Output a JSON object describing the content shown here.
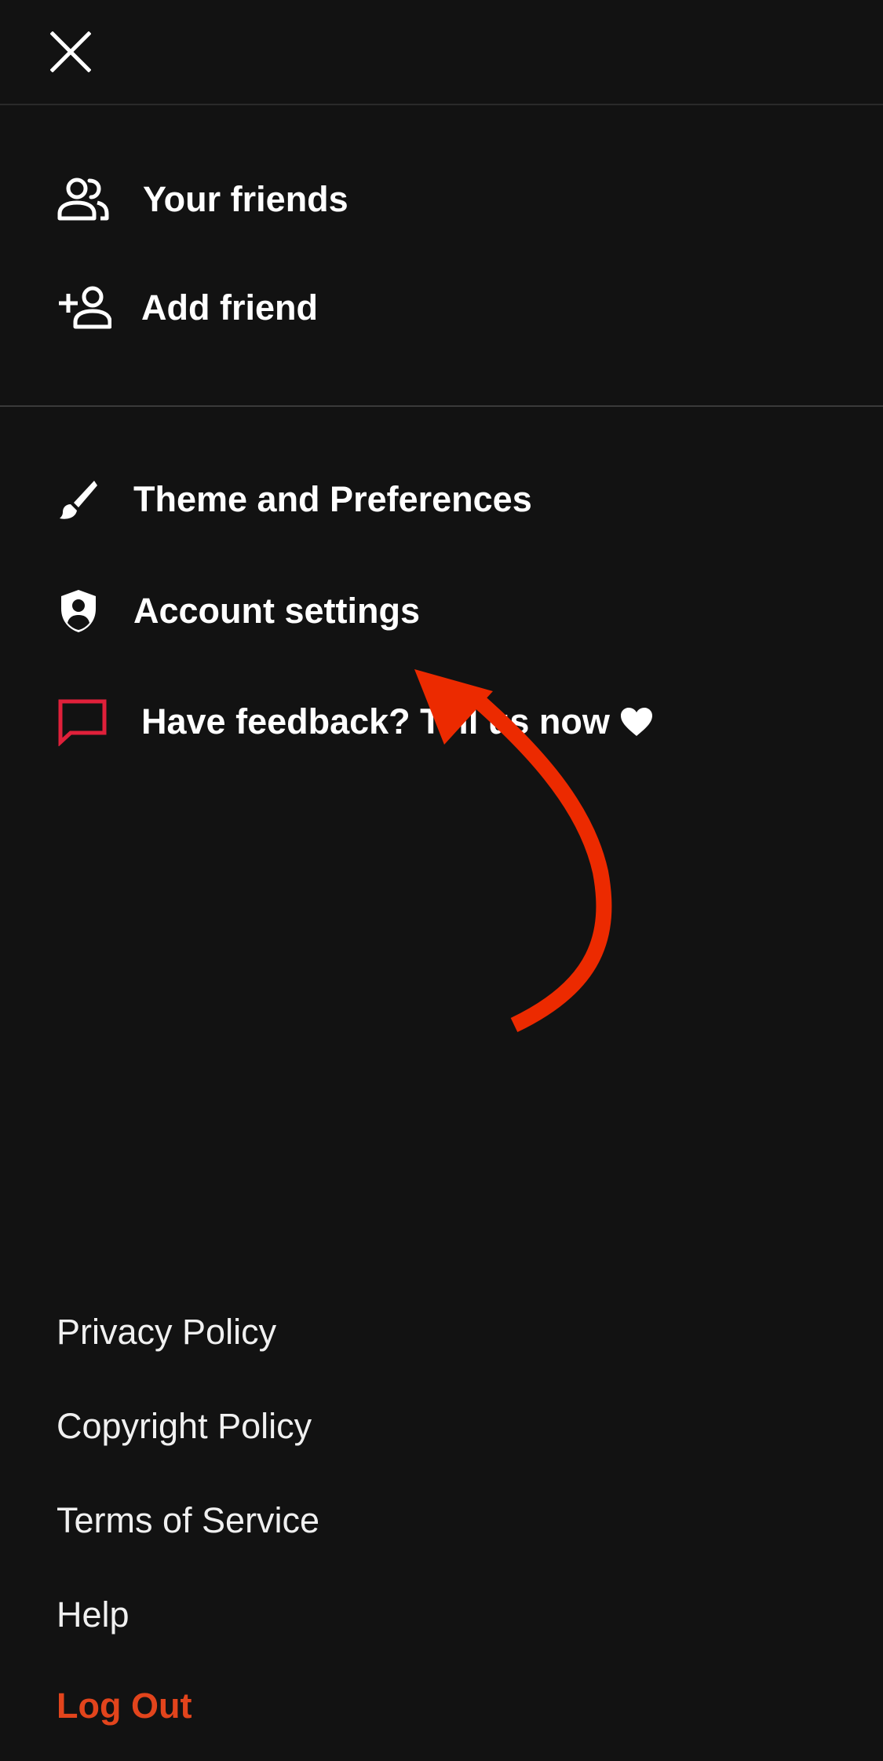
{
  "header": {
    "close_icon": "close-icon"
  },
  "friends_section": {
    "items": [
      {
        "label": "Your friends",
        "icon": "people-icon"
      },
      {
        "label": "Add friend",
        "icon": "add-person-icon"
      }
    ]
  },
  "settings_section": {
    "items": [
      {
        "label": "Theme and Preferences",
        "icon": "brush-icon"
      },
      {
        "label": "Account settings",
        "icon": "shield-person-icon"
      },
      {
        "label": "Have feedback? Tell us now",
        "icon": "chat-bubble-icon",
        "suffix_icon": "heart-icon",
        "icon_color": "#e0203a"
      }
    ]
  },
  "footer": {
    "links": [
      {
        "label": "Privacy Policy"
      },
      {
        "label": "Copyright Policy"
      },
      {
        "label": "Terms of Service"
      },
      {
        "label": "Help"
      }
    ],
    "logout_label": "Log Out",
    "logout_color": "#e2441c"
  },
  "annotation": {
    "arrow_color": "#ec2a00"
  }
}
